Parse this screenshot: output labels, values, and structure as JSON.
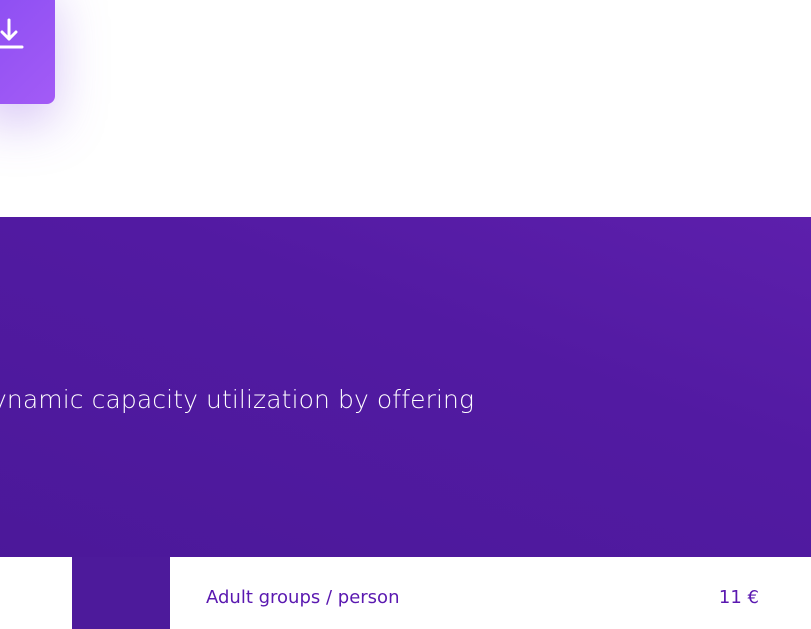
{
  "download": {
    "icon": "download-icon"
  },
  "hero": {
    "text": "ynamic capacity utilization by offering"
  },
  "pricing": {
    "rows": [
      {
        "label": "Adult groups / person",
        "price": "11 €"
      }
    ]
  },
  "colors": {
    "accent": "#9b57f5",
    "hero_background": "#521aa2",
    "price_text": "#5a18b0"
  }
}
